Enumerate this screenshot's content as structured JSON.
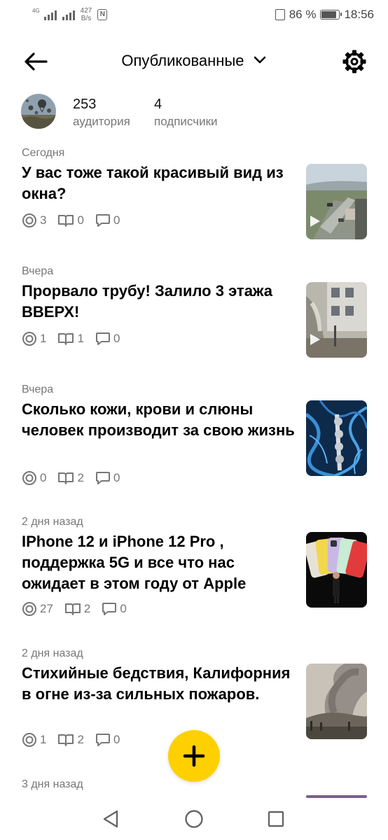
{
  "status_bar": {
    "network_tag": "4G",
    "speed_value": "427",
    "speed_unit": "B/s",
    "nfc": "N",
    "battery": "86 %",
    "time": "18:56",
    "battery_level": 0.86
  },
  "header": {
    "title": "Опубликованные",
    "icons": [
      "arrow-left-icon",
      "chevron-down-icon",
      "gear-icon"
    ]
  },
  "profile": {
    "audience_count": "253",
    "audience_label": "аудитория",
    "subscribers_count": "4",
    "subscribers_label": "подписчики"
  },
  "colors": {
    "fab": "#ffd000",
    "secondary_text": "#777777"
  },
  "posts": [
    {
      "when": "Сегодня",
      "title": "У вас тоже такой красивый вид из окна?",
      "views": "3",
      "reads": "0",
      "comments": "0",
      "video": true
    },
    {
      "when": "Вчера",
      "title": "Прорвало трубу! Залило 3 этажа ВВЕРХ!",
      "views": "1",
      "reads": "1",
      "comments": "0",
      "video": true
    },
    {
      "when": "Вчера",
      "title": "Сколько кожи, крови и слюны человек производит за свою жизнь",
      "views": "0",
      "reads": "2",
      "comments": "0",
      "video": false
    },
    {
      "when": "2 дня назад",
      "title": "IPhone 12 и iPhone 12 Pro , поддержка 5G и все что нас ожидает в этом году от Apple",
      "views": "27",
      "reads": "2",
      "comments": "0",
      "video": false
    },
    {
      "when": "2 дня назад",
      "title": "Стихийные бедствия, Калифорния в огне из-за сильных пожаров.",
      "views": "1",
      "reads": "2",
      "comments": "0",
      "video": false
    },
    {
      "when": "3 дня назад"
    }
  ],
  "fab_icon": "plus-icon",
  "nav": [
    "back-triangle-icon",
    "home-circle-icon",
    "recents-square-icon"
  ]
}
